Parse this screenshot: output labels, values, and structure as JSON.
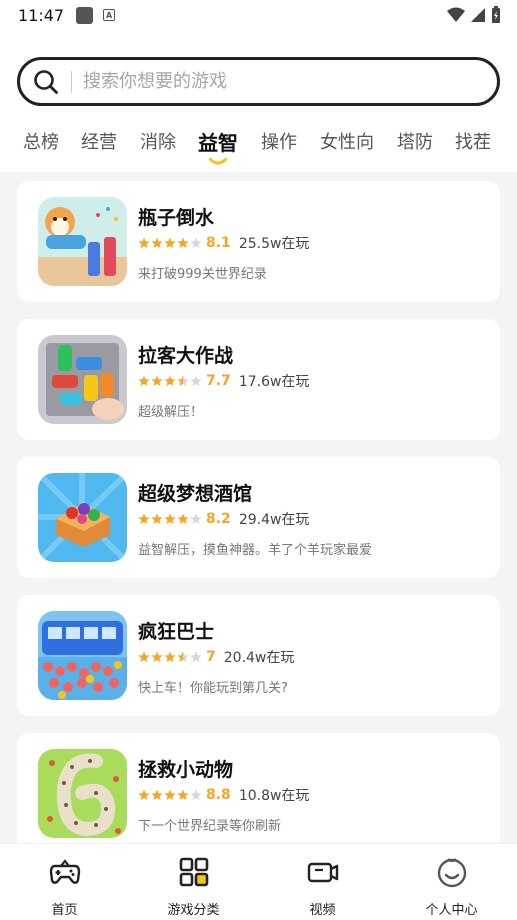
{
  "status_bar": {
    "time": "11:47"
  },
  "search": {
    "placeholder": "搜索你想要的游戏"
  },
  "tabs": [
    {
      "label": "总榜"
    },
    {
      "label": "经营"
    },
    {
      "label": "消除"
    },
    {
      "label": "益智"
    },
    {
      "label": "操作"
    },
    {
      "label": "女性向"
    },
    {
      "label": "塔防"
    },
    {
      "label": "找茬"
    }
  ],
  "active_tab": "益智",
  "accent_color": "#f5c518",
  "star_color": "#f5a623",
  "games": [
    {
      "name": "瓶子倒水",
      "score": "8.1",
      "stars_filled": 4,
      "stars_half": 0,
      "plays": "25.5w在玩",
      "desc": "来打破999关世界纪录"
    },
    {
      "name": "拉客大作战",
      "score": "7.7",
      "stars_filled": 3,
      "stars_half": 1,
      "plays": "17.6w在玩",
      "desc": "超级解压！"
    },
    {
      "name": "超级梦想酒馆",
      "score": "8.2",
      "stars_filled": 4,
      "stars_half": 0,
      "plays": "29.4w在玩",
      "desc": "益智解压，摸鱼神器。羊了个羊玩家最爱"
    },
    {
      "name": "疯狂巴士",
      "score": "7",
      "stars_filled": 3,
      "stars_half": 1,
      "plays": "20.4w在玩",
      "desc": "快上车！你能玩到第几关?"
    },
    {
      "name": "拯救小动物",
      "score": "8.8",
      "stars_filled": 4,
      "stars_half": 0,
      "plays": "10.8w在玩",
      "desc": "下一个世界纪录等你刷新"
    }
  ],
  "bottom_nav": [
    {
      "label": "首页",
      "icon": "gamepad-icon"
    },
    {
      "label": "游戏分类",
      "icon": "grid-icon"
    },
    {
      "label": "视频",
      "icon": "video-icon"
    },
    {
      "label": "个人中心",
      "icon": "smile-icon"
    }
  ]
}
